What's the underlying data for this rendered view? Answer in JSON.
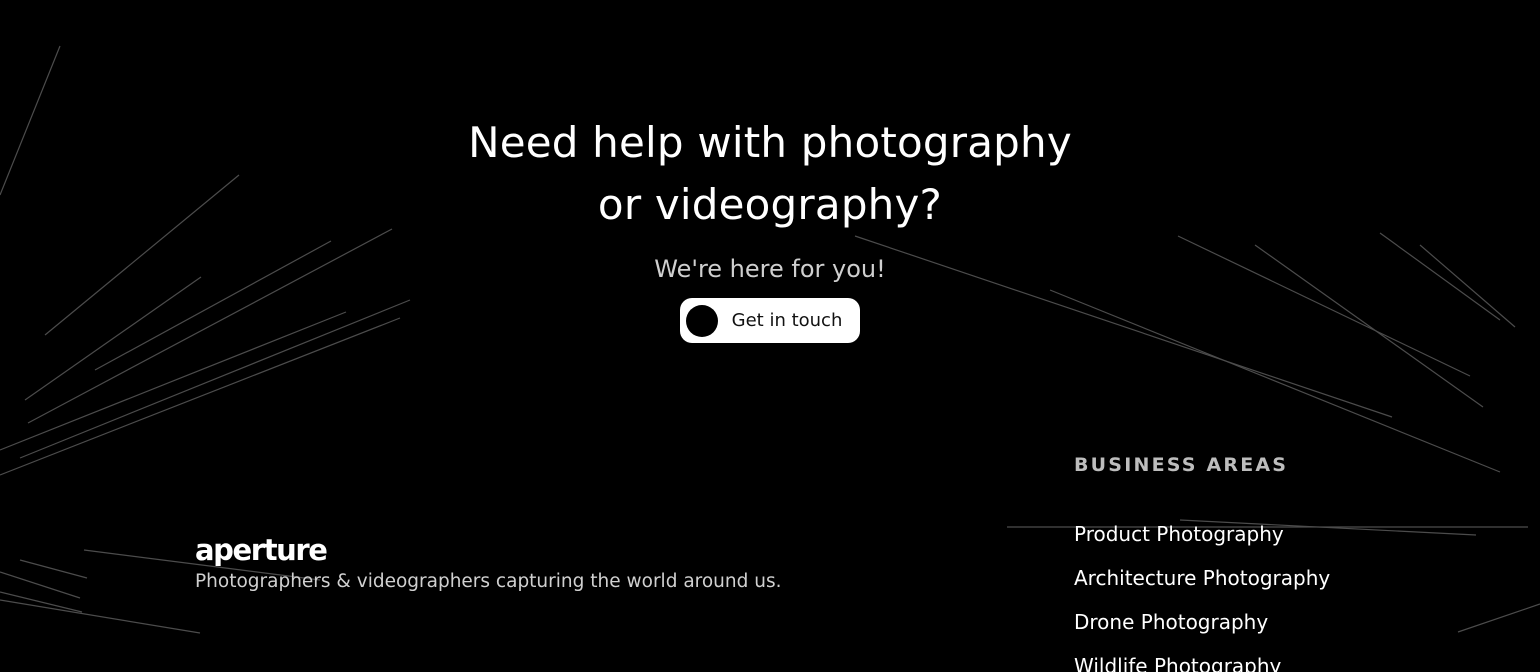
{
  "hero": {
    "title_line1": "Need help with photography",
    "title_line2": "or videography?",
    "subtitle": "We're here for you!",
    "cta_label": "Get in touch"
  },
  "brand": {
    "logo_text": "aperture",
    "tagline": "Photographers & videographers capturing the world around us."
  },
  "business_areas": {
    "heading": "BUSINESS AREAS",
    "items": [
      "Product Photography",
      "Architecture Photography",
      "Drone Photography",
      "Wildlife Photography"
    ]
  },
  "colors": {
    "background": "#000000",
    "text": "#ffffff",
    "muted": "#bdbdbd",
    "button_bg": "#ffffff"
  }
}
